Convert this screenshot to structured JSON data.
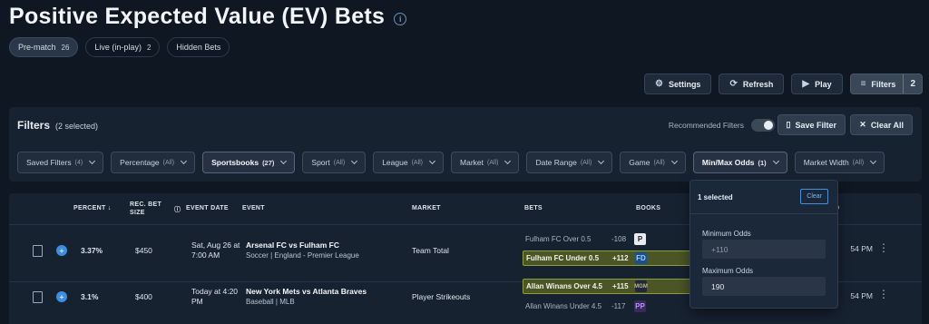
{
  "header": {
    "title": "Positive Expected Value (EV) Bets",
    "info_icon": "i"
  },
  "tabs": [
    {
      "label": "Pre-match",
      "count": "26"
    },
    {
      "label": "Live (in-play)",
      "count": "2"
    },
    {
      "label": "Hidden Bets",
      "count": ""
    }
  ],
  "toolbar": {
    "settings": "Settings",
    "refresh": "Refresh",
    "play": "Play",
    "filters": "Filters",
    "filters_count": "2"
  },
  "filters_panel": {
    "title": "Filters",
    "selected": "(2 selected)",
    "recommended_label": "Recommended Filters",
    "save_label": "Save Filter",
    "clear_all_label": "Clear All",
    "chips": [
      {
        "label": "Saved Filters",
        "sub": "(4)"
      },
      {
        "label": "Percentage",
        "sub": "(All)"
      },
      {
        "label": "Sportsbooks",
        "sub": "(27)"
      },
      {
        "label": "Sport",
        "sub": "(All)"
      },
      {
        "label": "League",
        "sub": "(All)"
      },
      {
        "label": "Market",
        "sub": "(All)"
      },
      {
        "label": "Date Range",
        "sub": "(All)"
      },
      {
        "label": "Game",
        "sub": "(All)"
      },
      {
        "label": "Min/Max Odds",
        "sub": "(1)"
      },
      {
        "label": "Market Width",
        "sub": "(All)"
      }
    ]
  },
  "table": {
    "headers": {
      "percent": "PERCENT",
      "rec_bet_1": "REC. BET",
      "rec_bet_2": "SIZE",
      "event_date": "EVENT DATE",
      "event": "EVENT",
      "market": "MARKET",
      "bets": "BETS",
      "books": "BOOKS",
      "last": "D"
    },
    "rows": [
      {
        "percent": "3.37%",
        "bet_size": "$450",
        "date_1": "Sat, Aug 26 at",
        "date_2": "7:00 AM",
        "event": "Arsenal FC vs Fulham FC",
        "league": "Soccer | England - Premier League",
        "market": "Team Total",
        "bet_a": "Fulham FC Over 0.5",
        "odds_a": "-108",
        "book_a": "P",
        "bet_b": "Fulham FC Under 0.5",
        "odds_b": "+112",
        "book_b": "FD",
        "time": "54 PM"
      },
      {
        "percent": "3.1%",
        "bet_size": "$400",
        "date_1": "Today at 4:20",
        "date_2": "PM",
        "event": "New York Mets vs Atlanta Braves",
        "league": "Baseball | MLB",
        "market": "Player Strikeouts",
        "bet_a": "Allan Winans Over 4.5",
        "odds_a": "+115",
        "book_a": "MGM",
        "bet_b": "Allan Winans Under 4.5",
        "odds_b": "-117",
        "book_b": "PP",
        "time": "54 PM"
      }
    ]
  },
  "popover": {
    "selected": "1 selected",
    "clear": "Clear",
    "min_label": "Minimum Odds",
    "min_placeholder": "+110",
    "max_label": "Maximum Odds",
    "max_value": "190"
  }
}
